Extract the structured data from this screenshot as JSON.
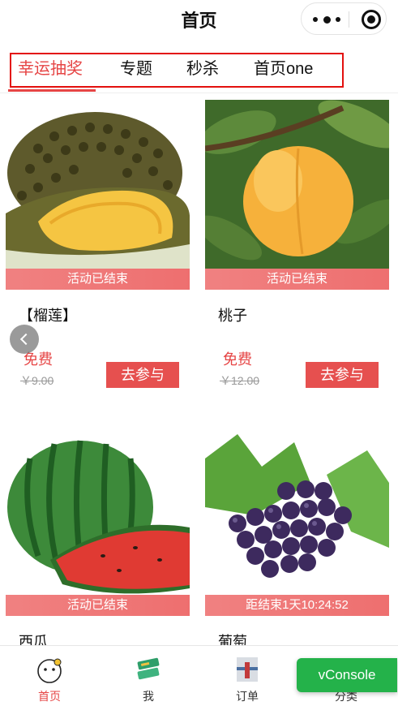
{
  "navbar": {
    "title": "首页",
    "more_icon": "more-dots-icon",
    "close_icon": "target-circle-icon"
  },
  "tabs": {
    "items": [
      {
        "label": "幸运抽奖",
        "active": true
      },
      {
        "label": "专题",
        "active": false
      },
      {
        "label": "秒杀",
        "active": false
      },
      {
        "label": "首页one",
        "active": false
      }
    ],
    "accent": "#e64545"
  },
  "products": [
    {
      "name": "【榴莲】",
      "status": "活动已结束",
      "price": "免费",
      "original_price": "￥9.00",
      "action": "去参与",
      "image": "durian"
    },
    {
      "name": "桃子",
      "status": "活动已结束",
      "price": "免费",
      "original_price": "￥12.00",
      "action": "去参与",
      "image": "peach"
    },
    {
      "name": "西瓜",
      "status": "活动已结束",
      "image": "watermelon"
    },
    {
      "name": "葡萄",
      "status": "距结束1天10:24:52",
      "image": "grapes"
    }
  ],
  "tabbar": {
    "items": [
      {
        "label": "首页",
        "icon": "home-mascot-icon",
        "active": true
      },
      {
        "label": "我",
        "icon": "user-ticket-icon",
        "active": false
      },
      {
        "label": "订单",
        "icon": "order-icon",
        "active": false
      },
      {
        "label": "分类",
        "icon": "category-icon",
        "active": false
      }
    ]
  },
  "vconsole": {
    "label": "vConsole",
    "color": "#24b24a"
  }
}
